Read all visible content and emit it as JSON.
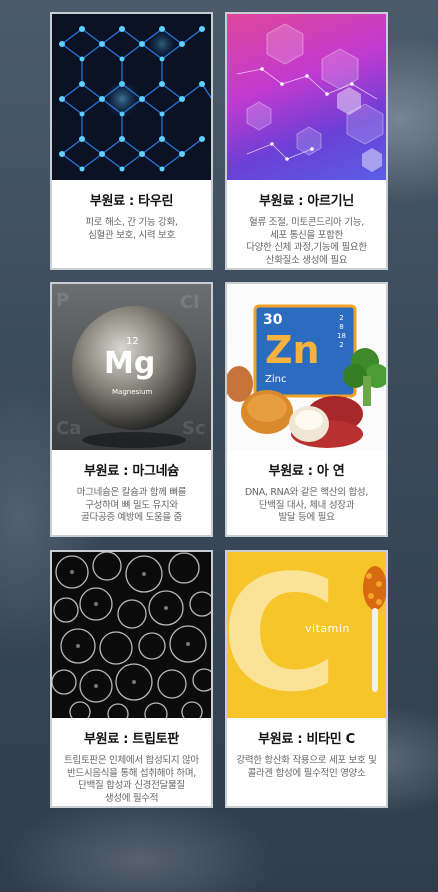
{
  "cards": [
    {
      "title": "부원료 : 타우린",
      "desc": [
        "피로 해소, 간 기능 강화,",
        "심혈관 보호, 시력 보호"
      ]
    },
    {
      "title": "부원료 : 아르기닌",
      "desc": [
        "혈류 조절, 미토콘드리아 기능,",
        "세포 통신을 포함한",
        "다양한 신체 과정,기능에 필요한",
        "산화질소 생성에 필요"
      ]
    },
    {
      "title": "부원료 : 마그네슘",
      "desc": [
        "마그네슘은 칼슘과 함께 뼈를",
        "구성하며 뼈 밀도 유지와",
        "골다공증 예방에 도움을 줌"
      ]
    },
    {
      "title": "부원료 : 아 연",
      "desc": [
        "DNA, RNA와 같은 핵산의 합성,",
        "단백질 대사, 체내 성장과",
        "발달 등에 필요"
      ]
    },
    {
      "title": "부원료 : 트립토판",
      "desc": [
        "트립토판은 인체에서 합성되지 않아",
        "반드시음식을 통해  섭취해야 하며,",
        "단백질 합성과 신경전달물질",
        "생성에 필수적"
      ]
    },
    {
      "title": "부원료 : 비타민 C",
      "desc": [
        "강력한 항산화 작용으로 세포 보호 및",
        "콜라겐 합성에 필수적인 영양소"
      ]
    }
  ],
  "mg_tile": {
    "number": "12",
    "symbol": "Mg",
    "name": "Magnesium"
  },
  "zn_tile": {
    "number": "30",
    "symbol": "Zn",
    "name": "Zinc",
    "shells": [
      "2",
      "8",
      "18",
      "2"
    ]
  },
  "vitamin_word": "vitamin",
  "vitamin_letter": "C"
}
